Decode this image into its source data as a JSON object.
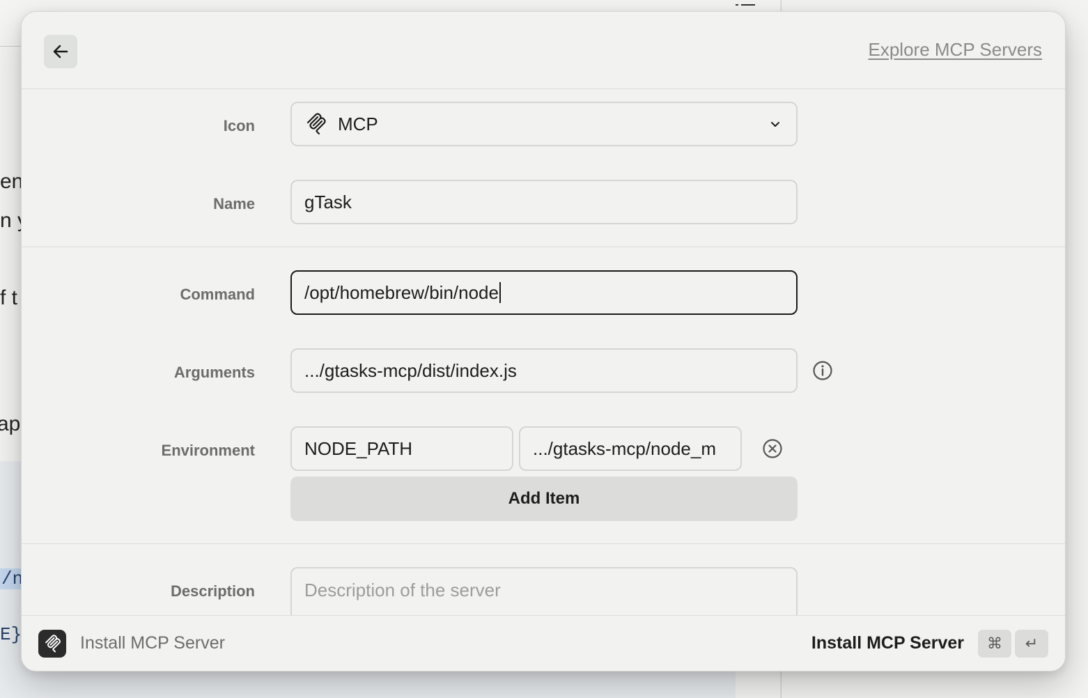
{
  "background": {
    "fragments": [
      "en",
      "n y",
      "f t",
      "app",
      "/n",
      "E}"
    ]
  },
  "header": {
    "back_icon": "arrow-left-icon",
    "explore_link": "Explore MCP Servers"
  },
  "form": {
    "icon": {
      "label": "Icon",
      "value": "MCP",
      "icon": "mcp-logo-icon",
      "dropdown_icon": "chevron-down-icon"
    },
    "name": {
      "label": "Name",
      "value": "gTask"
    },
    "command": {
      "label": "Command",
      "value": "/opt/homebrew/bin/node"
    },
    "arguments": {
      "label": "Arguments",
      "value": ".../gtasks-mcp/dist/index.js",
      "info_icon": "info-icon"
    },
    "environment": {
      "label": "Environment",
      "items": [
        {
          "key": "NODE_PATH",
          "value": ".../gtasks-mcp/node_m"
        }
      ],
      "remove_icon": "remove-circle-icon",
      "add_label": "Add Item"
    },
    "description": {
      "label": "Description",
      "placeholder": "Description of the server"
    }
  },
  "footer": {
    "title": "Install MCP Server",
    "action_label": "Install MCP Server",
    "shortcut_keys": [
      "⌘",
      "↵"
    ]
  }
}
